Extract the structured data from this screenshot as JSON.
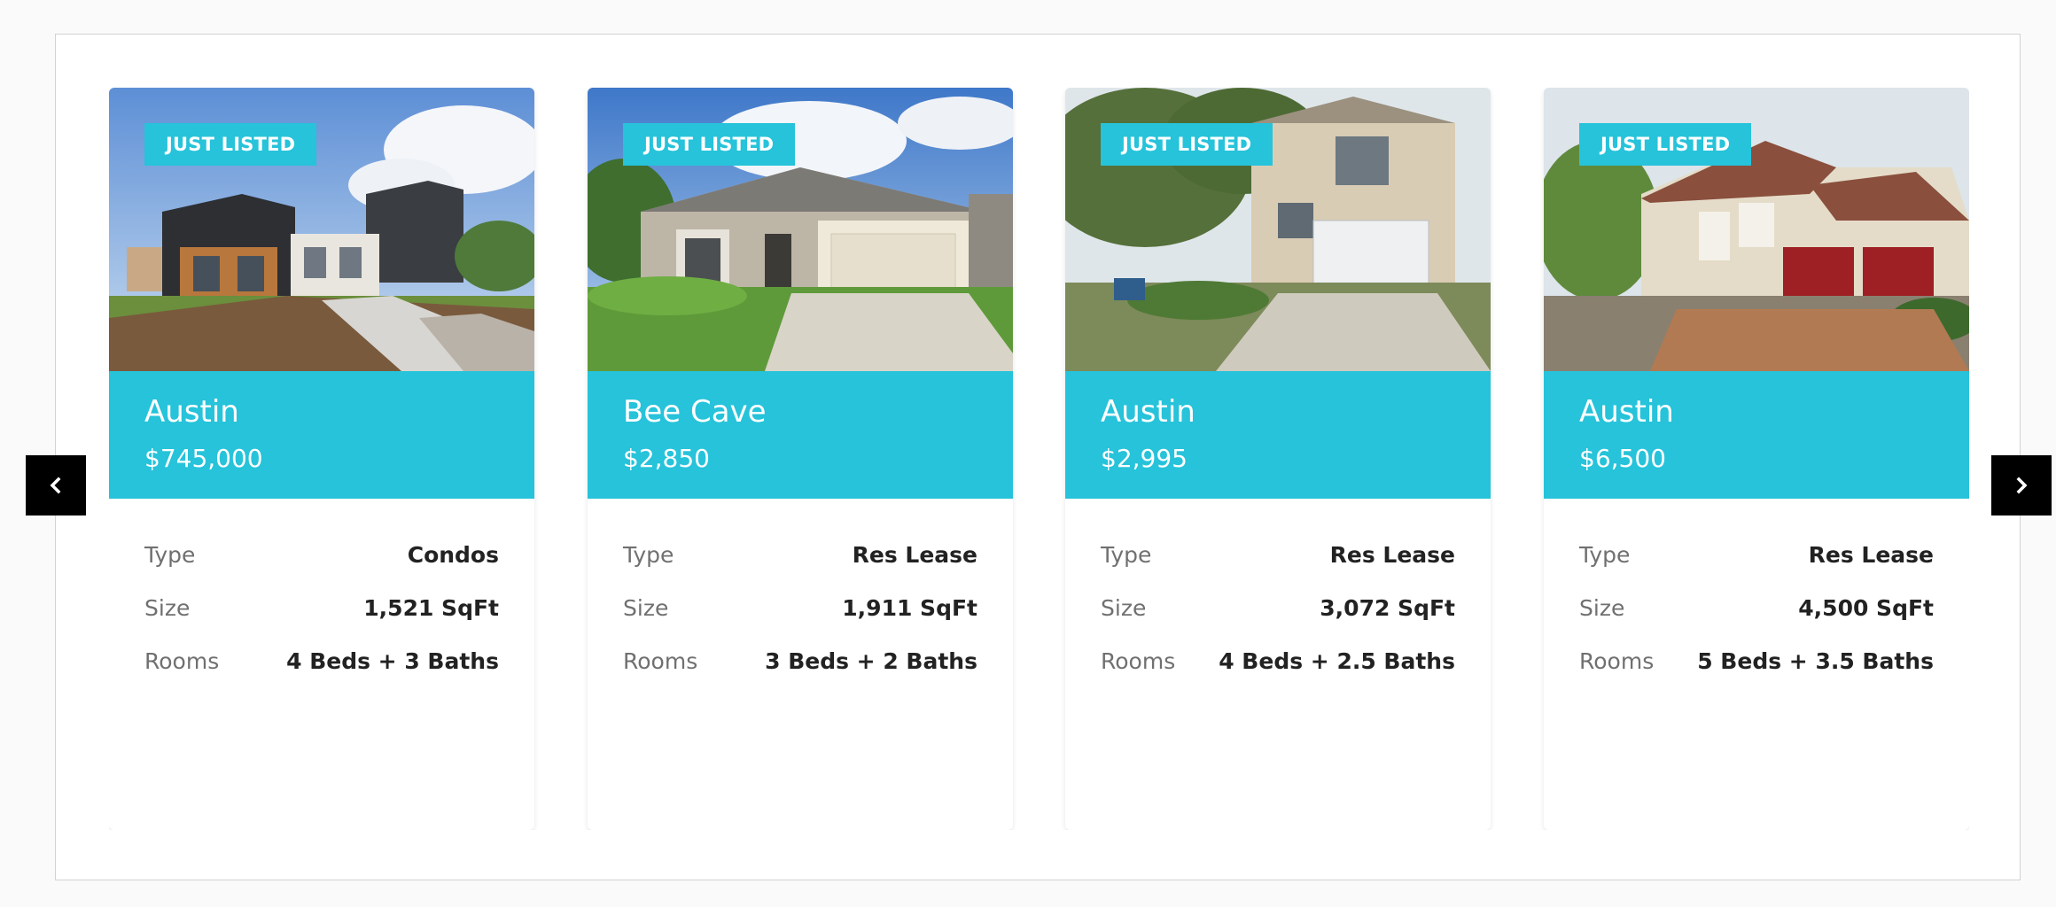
{
  "carousel": {
    "prev_icon": "chevron-left-icon",
    "next_icon": "chevron-right-icon",
    "listings": [
      {
        "badge": "JUST LISTED",
        "city": "Austin",
        "price": "$745,000",
        "specs": [
          {
            "label": "Type",
            "value": "Condos"
          },
          {
            "label": "Size",
            "value": "1,521 SqFt"
          },
          {
            "label": "Rooms",
            "value": "4 Beds + 3 Baths"
          }
        ]
      },
      {
        "badge": "JUST LISTED",
        "city": "Bee Cave",
        "price": "$2,850",
        "specs": [
          {
            "label": "Type",
            "value": "Res Lease"
          },
          {
            "label": "Size",
            "value": "1,911 SqFt"
          },
          {
            "label": "Rooms",
            "value": "3 Beds + 2 Baths"
          }
        ]
      },
      {
        "badge": "JUST LISTED",
        "city": "Austin",
        "price": "$2,995",
        "specs": [
          {
            "label": "Type",
            "value": "Res Lease"
          },
          {
            "label": "Size",
            "value": "3,072 SqFt"
          },
          {
            "label": "Rooms",
            "value": "4 Beds + 2.5 Baths"
          }
        ]
      },
      {
        "badge": "JUST LISTED",
        "city": "Austin",
        "price": "$6,500",
        "specs": [
          {
            "label": "Type",
            "value": "Res Lease"
          },
          {
            "label": "Size",
            "value": "4,500 SqFt"
          },
          {
            "label": "Rooms",
            "value": "5 Beds + 3.5 Baths"
          }
        ]
      }
    ]
  },
  "colors": {
    "accent": "#26c3da",
    "nav_background": "#000000",
    "label_text": "#707070",
    "value_text": "#222222"
  }
}
